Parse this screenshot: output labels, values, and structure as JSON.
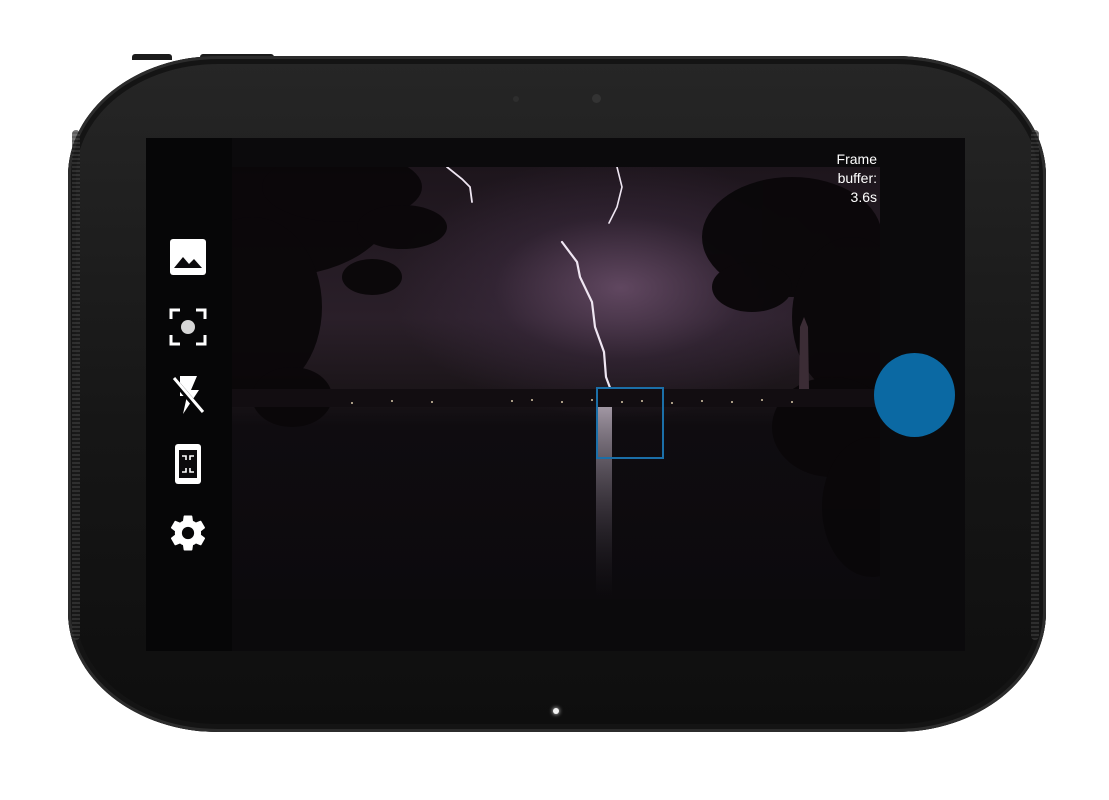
{
  "device": {
    "name": "tablet",
    "bezel_color": "#161616"
  },
  "camera": {
    "status": {
      "line1": "Frame",
      "line2": "buffer:",
      "line3": "3.6s"
    },
    "sidebar": [
      {
        "name": "gallery-icon",
        "label": "Gallery"
      },
      {
        "name": "focus-mode-icon",
        "label": "Focus mode"
      },
      {
        "name": "flash-off-icon",
        "label": "Flash off"
      },
      {
        "name": "frame-buffer-icon",
        "label": "Frame buffer"
      },
      {
        "name": "settings-icon",
        "label": "Settings"
      }
    ],
    "colors": {
      "accent": "#0b69a3",
      "focus_box": "#1b6fa8",
      "icon": "#ffffff"
    },
    "preview_subject": "night sky with lightning over water"
  }
}
